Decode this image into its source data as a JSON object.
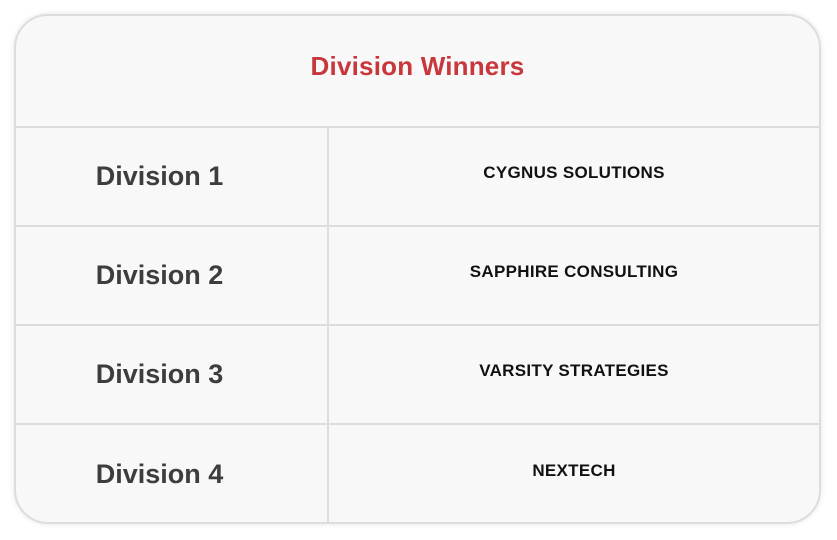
{
  "title": "Division Winners",
  "rows": [
    {
      "division": "Division 1",
      "winner": "CYGNUS SOLUTIONS"
    },
    {
      "division": "Division 2",
      "winner": "SAPPHIRE CONSULTING"
    },
    {
      "division": "Division 3",
      "winner": "VARSITY STRATEGIES"
    },
    {
      "division": "Division 4",
      "winner": "NEXTECH"
    }
  ],
  "colors": {
    "title": "#c7373b",
    "division_text": "#3d3d3d",
    "winner_text": "#111111",
    "border": "#dddddd",
    "card_background": "#f8f8f8"
  }
}
